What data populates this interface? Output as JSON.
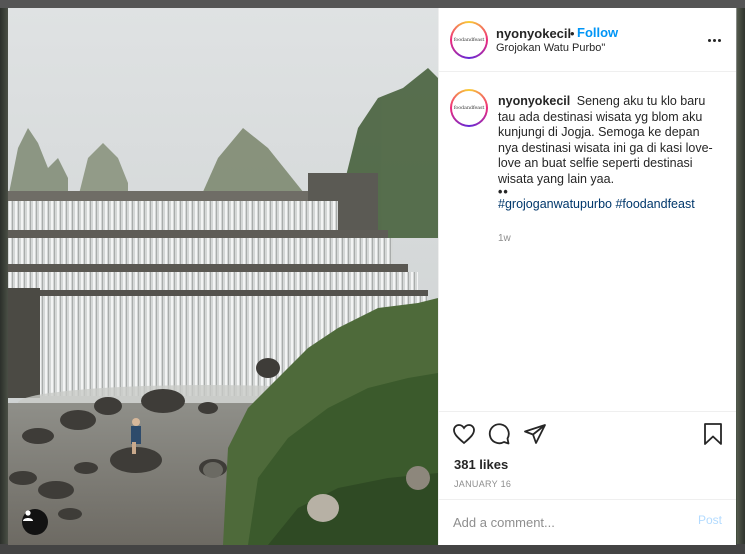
{
  "post": {
    "username": "nyonyokecil",
    "separator": "•",
    "follow_label": "Follow",
    "location": "Grojokan Watu Purbo\"",
    "avatar_logo_text": "foodandfeast"
  },
  "caption": {
    "username": "nyonyokecil",
    "text": "Seneng aku tu klo baru tau ada destinasi wisata yg blom aku kunjungi di Jogja. Semoga ke depan nya destinasi wisata ini ga di kasi love-love an buat selfie seperti destinasi wisata yang lain yaa.",
    "dots": "••",
    "hashtags": "#grojoganwatupurbo #foodandfeast",
    "time_ago": "1w"
  },
  "actions": {
    "like_icon": "heart-icon",
    "comment_icon": "comment-icon",
    "share_icon": "paper-plane-icon",
    "save_icon": "bookmark-icon",
    "likes": "381 likes",
    "date": "JANUARY 16"
  },
  "comment_box": {
    "placeholder": "Add a comment...",
    "post_label": "Post"
  },
  "colors": {
    "follow": "#0095f6",
    "hashtag": "#00376b",
    "post_disabled": "#b3dbff",
    "muted": "#8e8e8e"
  }
}
